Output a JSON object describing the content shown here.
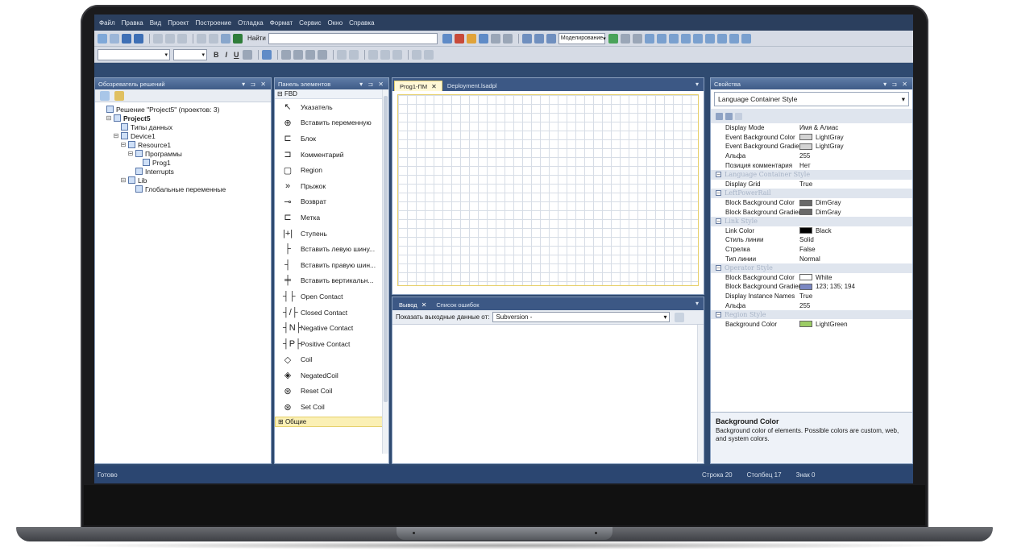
{
  "menu": [
    "Файл",
    "Правка",
    "Вид",
    "Проект",
    "Построение",
    "Отладка",
    "Формат",
    "Сервис",
    "Окно",
    "Справка"
  ],
  "toolbar": {
    "find_label": "Найти",
    "mode_label": "Моделирование"
  },
  "solution_explorer": {
    "title": "Обозреватель решений",
    "items": [
      {
        "text": "Решение \"Project5\" (проектов: 3)",
        "indent": 0
      },
      {
        "text": "Project5",
        "indent": 1,
        "bold": true
      },
      {
        "text": "Типы данных",
        "indent": 2
      },
      {
        "text": "Device1",
        "indent": 2
      },
      {
        "text": "Resource1",
        "indent": 3
      },
      {
        "text": "Программы",
        "indent": 4
      },
      {
        "text": "Prog1",
        "indent": 5
      },
      {
        "text": "Interrupts",
        "indent": 4
      },
      {
        "text": "Lib",
        "indent": 3
      },
      {
        "text": "Глобальные переменные",
        "indent": 4
      }
    ]
  },
  "toolbox": {
    "title": "Панель элементов",
    "group": "FBD",
    "items": [
      {
        "icon": "↖",
        "label": "Указатель"
      },
      {
        "icon": "⊕",
        "label": "Вставить переменную"
      },
      {
        "icon": "⊏",
        "label": "Блок"
      },
      {
        "icon": "⊐",
        "label": "Комментарий"
      },
      {
        "icon": "▢",
        "label": "Region"
      },
      {
        "icon": "»",
        "label": "Прыжок"
      },
      {
        "icon": "⊸",
        "label": "Возврат"
      },
      {
        "icon": "⊏",
        "label": "Метка"
      },
      {
        "icon": "|+|",
        "label": "Ступень"
      },
      {
        "icon": "├",
        "label": "Вставить левую шину..."
      },
      {
        "icon": "┤",
        "label": "Вставить правую шин..."
      },
      {
        "icon": "╪",
        "label": "Вставить вертикальн..."
      },
      {
        "icon": "┤├",
        "label": "Open Contact"
      },
      {
        "icon": "┤/├",
        "label": "Closed Contact"
      },
      {
        "icon": "┤N├",
        "label": "Negative Contact"
      },
      {
        "icon": "┤P├",
        "label": "Positive Contact"
      },
      {
        "icon": "◇",
        "label": "Coil"
      },
      {
        "icon": "◈",
        "label": "NegatedCoil"
      },
      {
        "icon": "⊛",
        "label": "Reset Coil"
      },
      {
        "icon": "⊛",
        "label": "Set Coil"
      }
    ],
    "footer": "Общие"
  },
  "document": {
    "tabs": [
      "Prog1-ПМ",
      "Deployment.lsadpl"
    ]
  },
  "output": {
    "tabs": [
      "Вывод",
      "Список ошибок"
    ],
    "source_label": "Показать выходные данные от:",
    "source_value": "Subversion -"
  },
  "properties": {
    "title": "Свойства",
    "object": "Language Container Style",
    "rows": [
      {
        "type": "prop",
        "name": "Display Mode",
        "value": "Имя & Алиас"
      },
      {
        "type": "prop",
        "name": "Event Background Color",
        "value": "LightGray",
        "color": "#d3d3d3"
      },
      {
        "type": "prop",
        "name": "Event Background Gradient C",
        "value": "LightGray",
        "color": "#d3d3d3"
      },
      {
        "type": "prop",
        "name": "Альфа",
        "value": "255"
      },
      {
        "type": "prop",
        "name": "Позиция комментария",
        "value": "Нет"
      },
      {
        "type": "cat",
        "name": "Language Container Style"
      },
      {
        "type": "prop",
        "name": "Display Grid",
        "value": "True"
      },
      {
        "type": "cat",
        "name": "LeftPowerRail"
      },
      {
        "type": "prop",
        "name": "Block Background Color",
        "value": "DimGray",
        "color": "#696969"
      },
      {
        "type": "prop",
        "name": "Block Background Gradient Cc",
        "value": "DimGray",
        "color": "#696969"
      },
      {
        "type": "cat",
        "name": "Link Style"
      },
      {
        "type": "prop",
        "name": "Link Color",
        "value": "Black",
        "color": "#000000"
      },
      {
        "type": "prop",
        "name": "Стиль линии",
        "value": "Solid"
      },
      {
        "type": "prop",
        "name": "Стрелка",
        "value": "False"
      },
      {
        "type": "prop",
        "name": "Тип линии",
        "value": "Normal"
      },
      {
        "type": "cat",
        "name": "Operator Style"
      },
      {
        "type": "prop",
        "name": "Block Background Color",
        "value": "White",
        "color": "#ffffff"
      },
      {
        "type": "prop",
        "name": "Block Background Gradient Cc",
        "value": "123; 135; 194",
        "color": "#7b87c2"
      },
      {
        "type": "prop",
        "name": "Display Instance Names",
        "value": "True"
      },
      {
        "type": "prop",
        "name": "Альфа",
        "value": "255"
      },
      {
        "type": "cat",
        "name": "Region Style"
      },
      {
        "type": "prop",
        "name": "Background Color",
        "value": "LightGreen",
        "color": "#9ccc65"
      }
    ],
    "desc_title": "Background Color",
    "desc_text": "Background color of elements. Possible colors are custom, web, and system colors."
  },
  "status": {
    "left": "Готово",
    "line": "Строка 20",
    "col": "Столбец 17",
    "char": "Знак 0"
  }
}
